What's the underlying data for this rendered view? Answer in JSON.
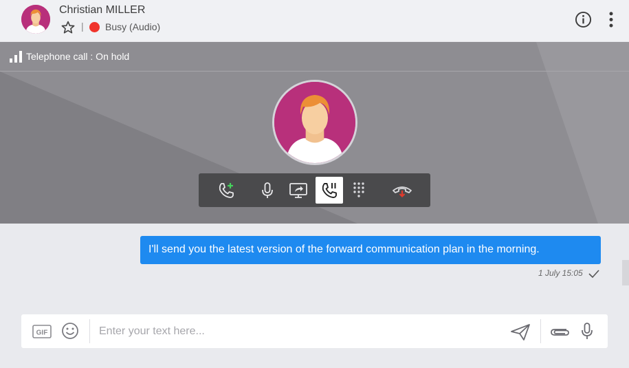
{
  "header": {
    "contact_name": "Christian MILLER",
    "separator": "|",
    "status_text": "Busy (Audio)",
    "status_color": "#f0332b",
    "icons": [
      "avatar",
      "star-icon",
      "info-icon",
      "more-vertical-icon"
    ]
  },
  "call": {
    "status_text": "Telephone call : On hold",
    "toolbar": [
      {
        "name": "add-call",
        "icon": "phone-plus-icon"
      },
      {
        "name": "microphone",
        "icon": "microphone-icon"
      },
      {
        "name": "screen-share",
        "icon": "screen-share-icon"
      },
      {
        "name": "hold",
        "icon": "phone-pause-icon",
        "active": true
      },
      {
        "name": "dialpad",
        "icon": "dialpad-icon"
      },
      {
        "name": "hang-up",
        "icon": "phone-hangup-icon"
      }
    ]
  },
  "messages": [
    {
      "text": "I'll send you the latest version of the forward communication plan in the morning.",
      "time": "1 July 15:05",
      "status": "sent"
    }
  ],
  "composer": {
    "placeholder": "Enter your text here...",
    "gif_label": "GIF",
    "icons": [
      "gif-icon",
      "emoji-icon",
      "send-icon",
      "attachment-icon",
      "microphone-icon"
    ]
  },
  "colors": {
    "accent": "#1e8af0",
    "busy": "#f0332b",
    "avatar_bg": "#b8307b",
    "call_bg": "#8e8d92"
  }
}
